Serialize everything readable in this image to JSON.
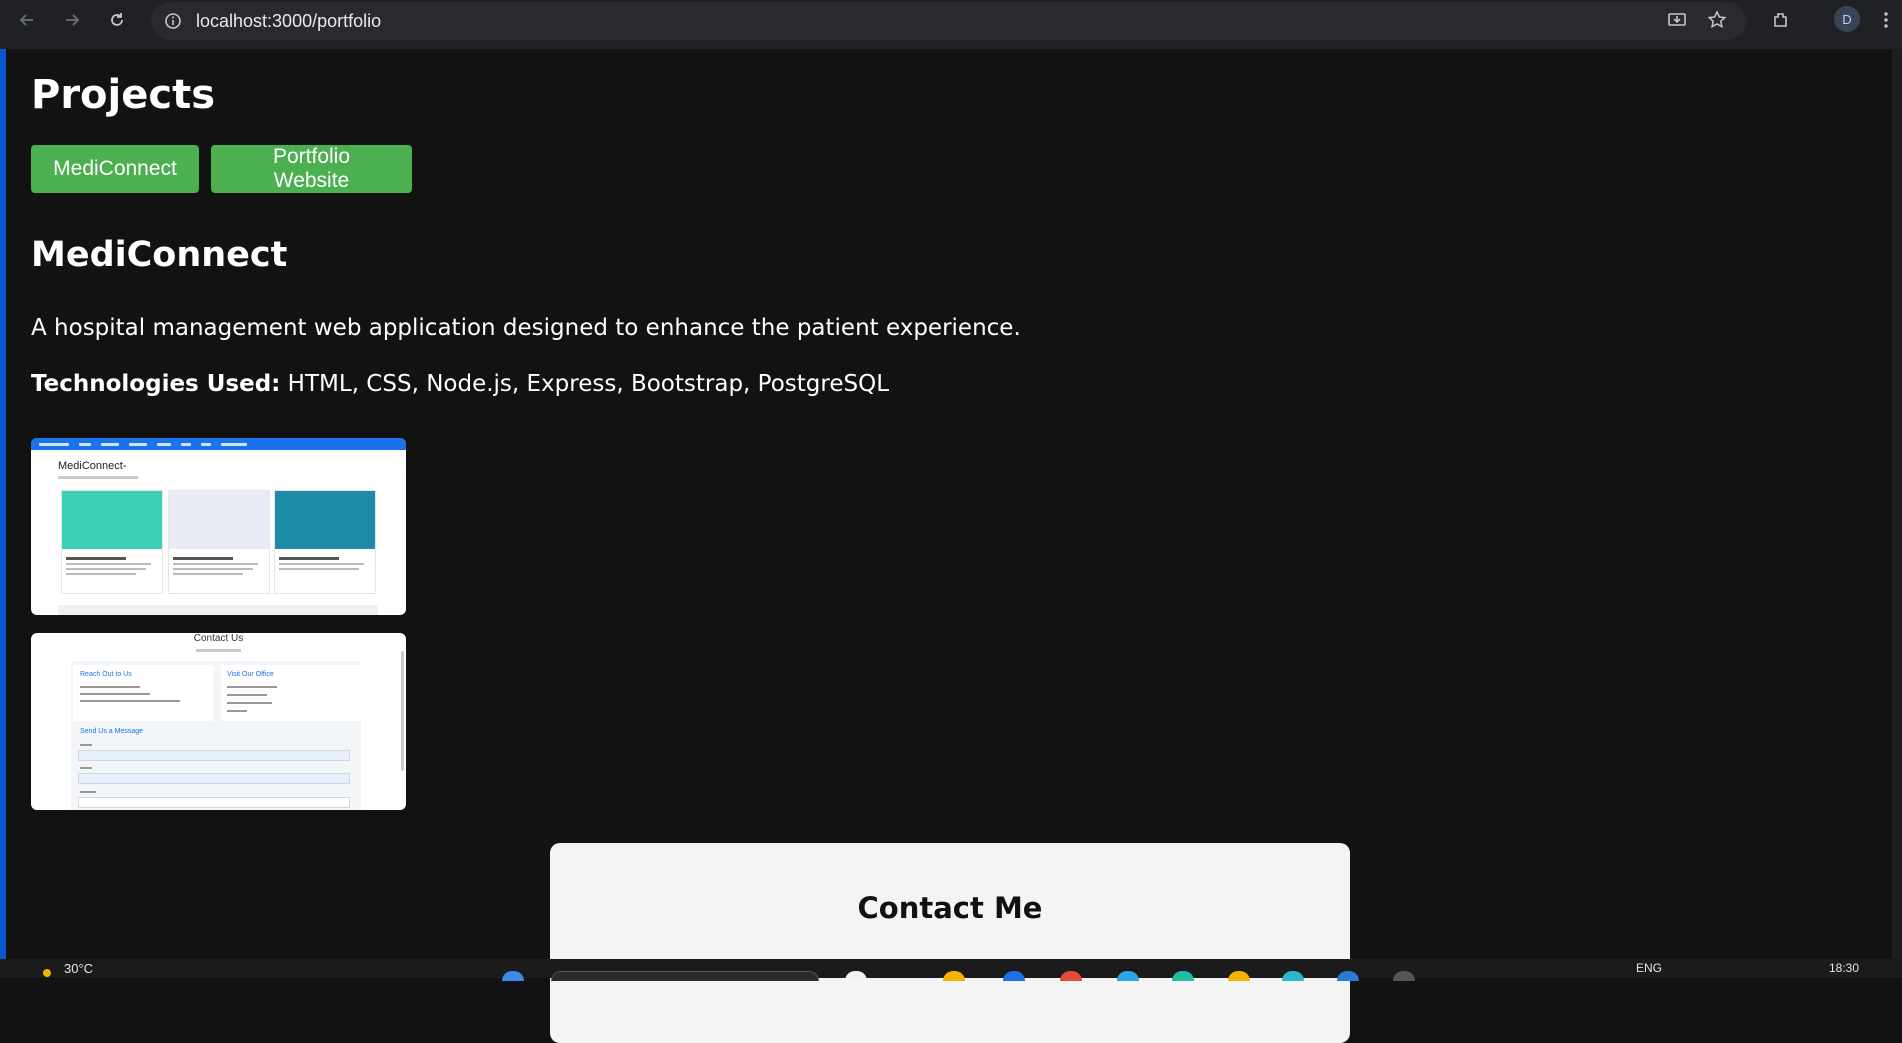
{
  "browser": {
    "url": "localhost:3000/portfolio",
    "profile_initial": "D",
    "icons": [
      "back-icon",
      "forward-icon",
      "reload-icon",
      "site-info-icon",
      "install-icon",
      "star-icon",
      "extensions-icon",
      "menu-icon"
    ]
  },
  "page": {
    "section_title": "Projects",
    "project_buttons": [
      "MediConnect",
      "Portfolio Website"
    ],
    "project": {
      "title": "MediConnect",
      "description": "A hospital management web application designed to enhance the patient experience.",
      "tech_label": "Technologies Used:",
      "tech_list": " HTML, CSS, Node.js, Express, Bootstrap, PostgreSQL",
      "screenshot1": {
        "title": "MediConnect-",
        "card_colors": [
          "#3ccfb3",
          "#e9ecf5",
          "#1d8aa8"
        ]
      },
      "screenshot2": {
        "title": "Contact Us",
        "reach_heading": "Reach Out to Us",
        "visit_heading": "Visit Our Office",
        "form_heading": "Send Us a Message"
      }
    },
    "contact": {
      "title": "Contact Me"
    }
  },
  "taskbar": {
    "temperature": "30°C",
    "language": "ENG",
    "time": "18:30"
  },
  "colors": {
    "accent_green": "#4caf50",
    "page_bg": "#121212",
    "chrome_bg": "#202124"
  }
}
